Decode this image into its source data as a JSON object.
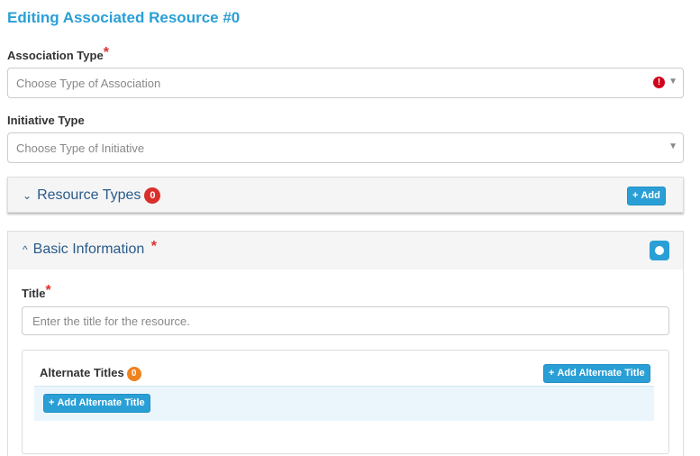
{
  "page": {
    "title": "Editing Associated Resource #0"
  },
  "association_type": {
    "label": "Association Type",
    "required_mark": "*",
    "placeholder": "Choose Type of Association",
    "error_icon": "exclamation-circle-icon",
    "error_color": "#d0021b"
  },
  "initiative_type": {
    "label": "Initiative Type",
    "placeholder": "Choose Type of Initiative"
  },
  "resource_types": {
    "title": "Resource Types",
    "count": "0",
    "add_label": "Add",
    "collapsed": true
  },
  "basic_information": {
    "title": "Basic Information",
    "required_mark": "*",
    "expanded": true,
    "title_field": {
      "label": "Title",
      "required_mark": "*",
      "placeholder": "Enter the title for the resource."
    },
    "alternate_titles": {
      "label": "Alternate Titles",
      "count": "0",
      "add_header_label": "Add Alternate Title",
      "add_row_label": "Add Alternate Title"
    }
  },
  "colors": {
    "accent": "#2a9fd6",
    "panel_title": "#2a5b8a",
    "required": "#e02e2e",
    "badge_red": "#d9302b",
    "badge_orange": "#f0821e"
  }
}
